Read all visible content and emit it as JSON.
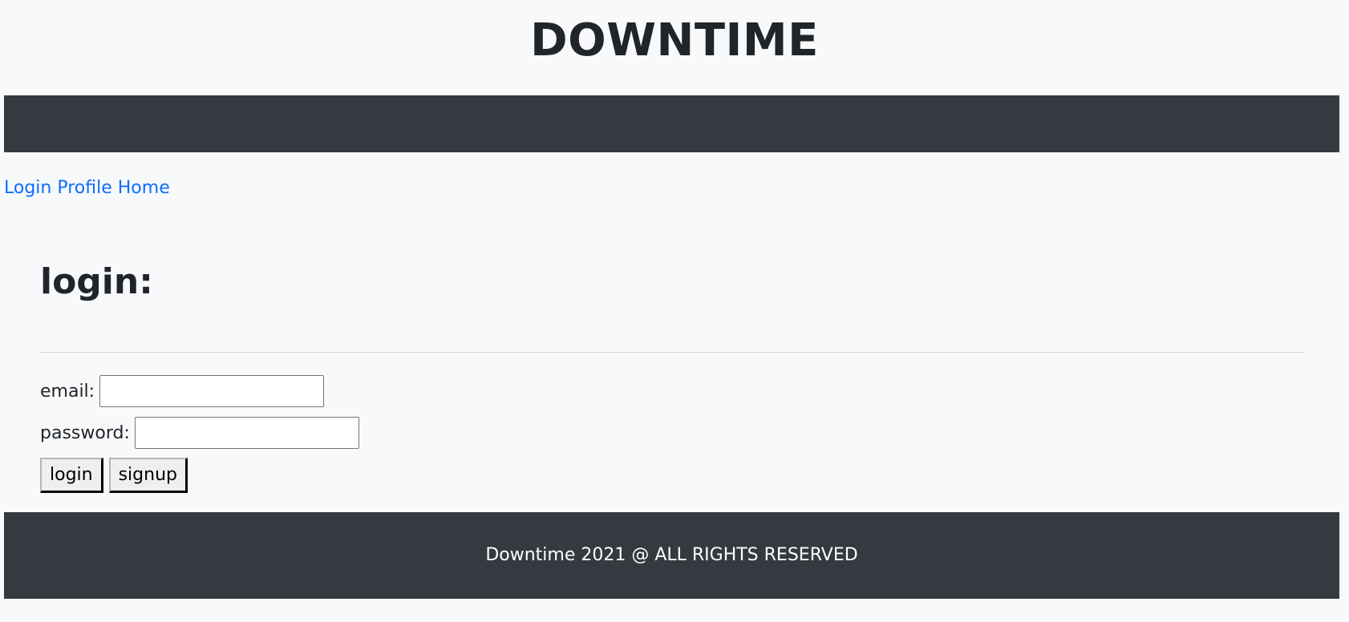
{
  "header": {
    "title": "DOWNTIME"
  },
  "nav": {
    "links": [
      "Login",
      "Profile",
      "Home"
    ]
  },
  "login_form": {
    "heading": "login:",
    "email_label": "email:",
    "email_value": "",
    "password_label": "password:",
    "password_value": "",
    "login_button": "login",
    "signup_button": "signup"
  },
  "footer": {
    "text": "Downtime 2021 @ ALL RIGHTS RESERVED"
  },
  "colors": {
    "background": "#f8f9fa",
    "bar": "#343a40",
    "link": "#0d6efd",
    "text": "#212529"
  }
}
